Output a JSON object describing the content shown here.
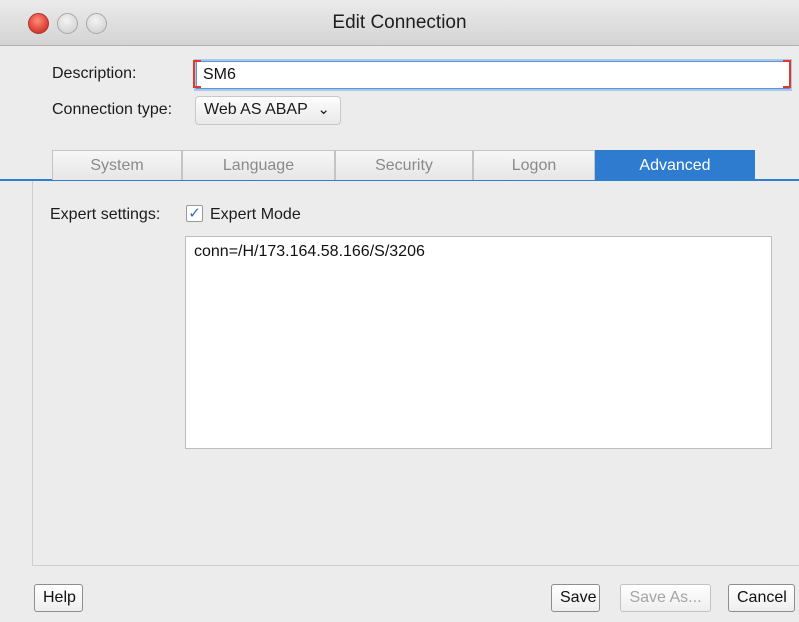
{
  "window": {
    "title": "Edit Connection"
  },
  "form": {
    "description_label": "Description:",
    "description_value": "SM6",
    "connection_type_label": "Connection type:",
    "connection_type_value": "Web AS ABAP"
  },
  "tabs": [
    {
      "label": "System",
      "active": false
    },
    {
      "label": "Language",
      "active": false
    },
    {
      "label": "Security",
      "active": false
    },
    {
      "label": "Logon",
      "active": false
    },
    {
      "label": "Advanced",
      "active": true
    }
  ],
  "advanced": {
    "expert_settings_label": "Expert settings:",
    "expert_mode_label": "Expert Mode",
    "expert_mode_checked": true,
    "connection_string": "conn=/H/173.164.58.166/S/3206"
  },
  "buttons": {
    "help": "Help",
    "save": "Save",
    "save_as": "Save As...",
    "cancel": "Cancel"
  },
  "colors": {
    "accent": "#2d7cd0",
    "error": "#e2392c"
  },
  "icons": {
    "close": "close-traffic-light-icon",
    "minimize": "minimize-traffic-light-icon",
    "zoom": "zoom-traffic-light-icon",
    "checkbox": "checkmark-icon",
    "dropdown": "chevron-down-icon"
  }
}
